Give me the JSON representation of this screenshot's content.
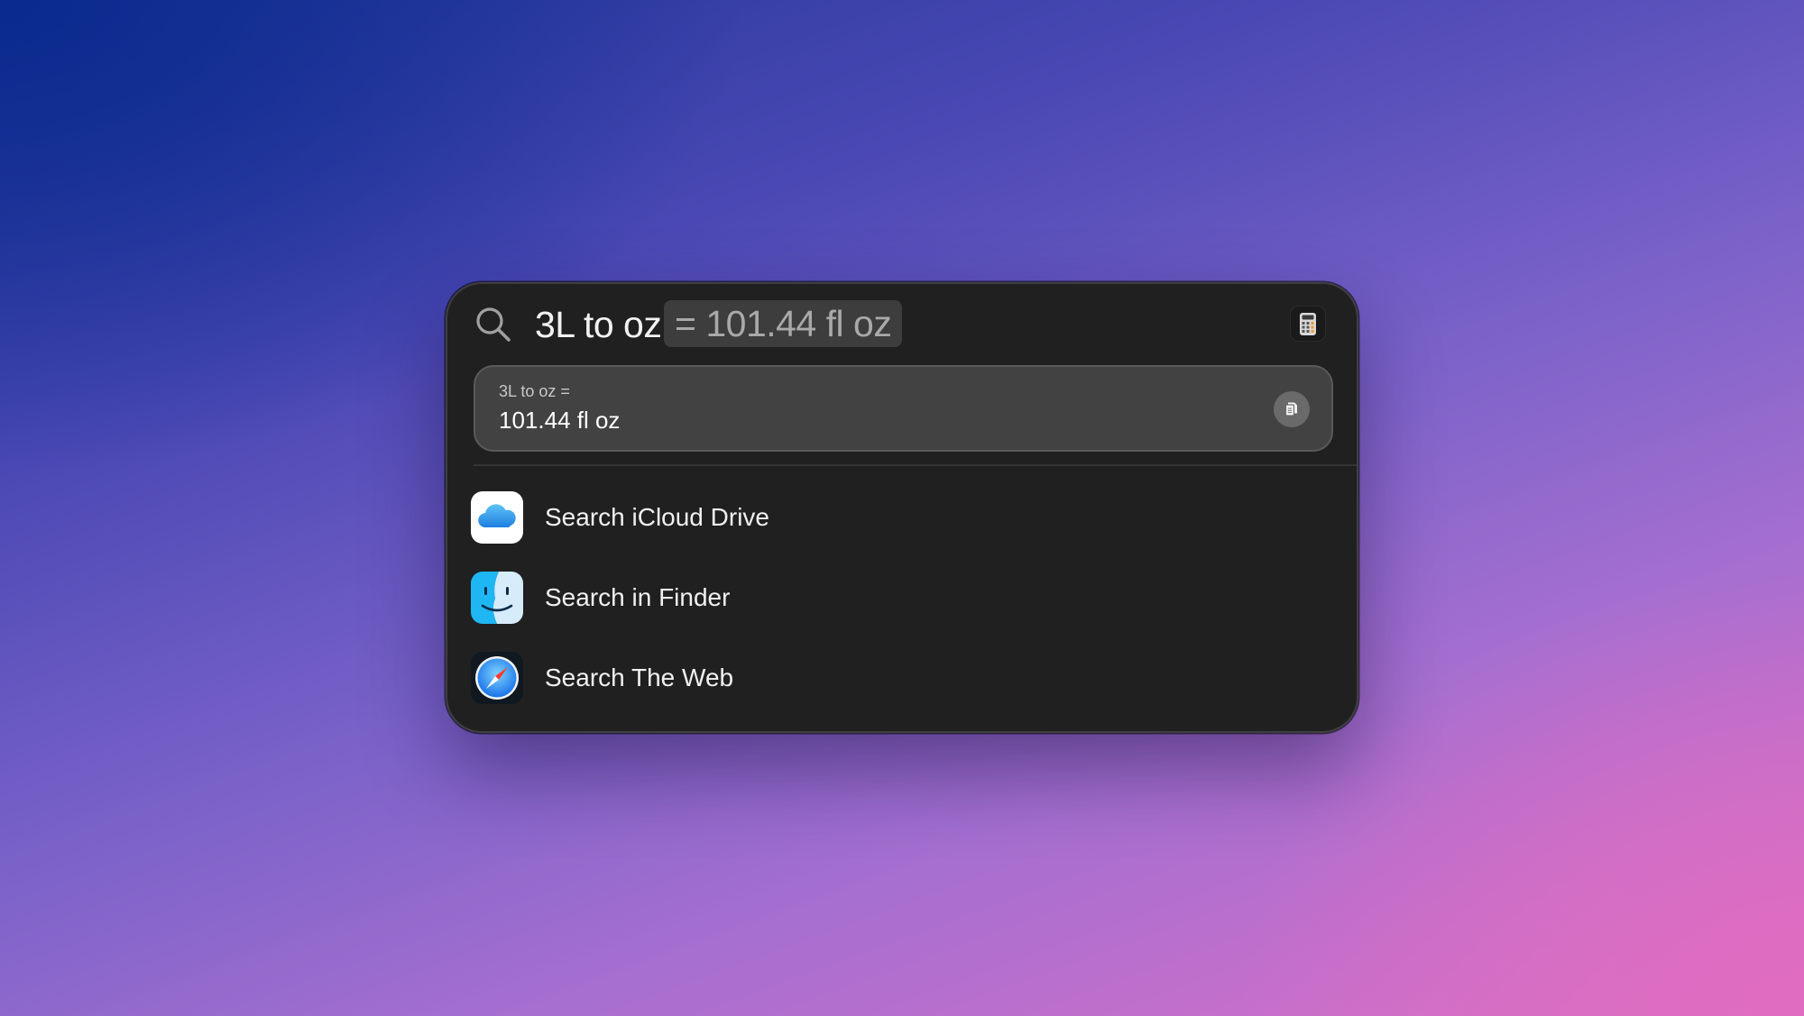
{
  "search": {
    "query": "3L to oz",
    "inline_result": "= 101.44 fl oz"
  },
  "calculator_result": {
    "expression": "3L to oz =",
    "value": "101.44 fl oz",
    "copy_icon": "copy-icon"
  },
  "header_app_icon": "calculator-app-icon",
  "results": [
    {
      "label": "Search iCloud Drive",
      "icon": "icloud-drive-icon"
    },
    {
      "label": "Search in Finder",
      "icon": "finder-icon"
    },
    {
      "label": "Search The Web",
      "icon": "safari-icon"
    }
  ],
  "colors": {
    "panel_background": "#202020",
    "result_card_background": "#424242",
    "inline_result_background": "#3d3d3d",
    "primary_text": "#f2f2f2",
    "secondary_text": "#a9a9a9"
  }
}
